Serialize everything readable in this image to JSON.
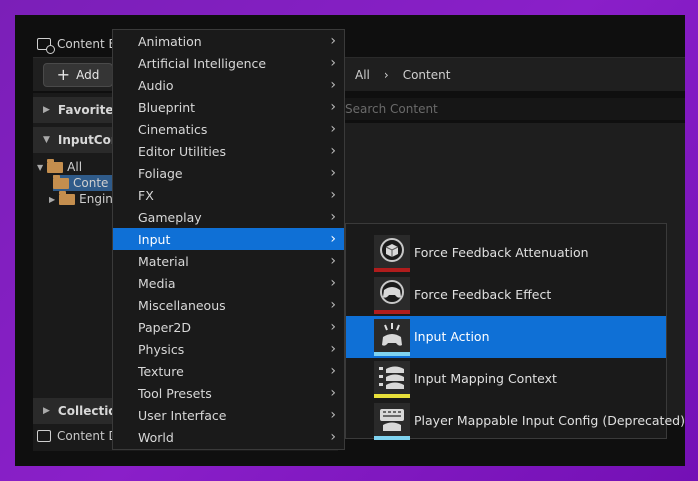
{
  "window": {
    "tab_title": "Content B",
    "add_button": "Add",
    "breadcrumb": [
      "All",
      "Content"
    ],
    "search_placeholder": "Search Content",
    "bottom_tab": "Content D"
  },
  "left_panel": {
    "favorites": "Favorites",
    "project": "InputCont",
    "collections": "Collection",
    "tree": [
      "All",
      "Conte",
      "Engin"
    ]
  },
  "menu": {
    "items": [
      "Animation",
      "Artificial Intelligence",
      "Audio",
      "Blueprint",
      "Cinematics",
      "Editor Utilities",
      "Foliage",
      "FX",
      "Gameplay",
      "Input",
      "Material",
      "Media",
      "Miscellaneous",
      "Paper2D",
      "Physics",
      "Texture",
      "Tool Presets",
      "User Interface",
      "World"
    ],
    "active_index": 9
  },
  "submenu": {
    "items": [
      {
        "label": "Force Feedback Attenuation",
        "icon": "force-feedback-attenuation-icon",
        "color": "#b01c1c"
      },
      {
        "label": "Force Feedback Effect",
        "icon": "force-feedback-effect-icon",
        "color": "#b01c1c"
      },
      {
        "label": "Input Action",
        "icon": "input-action-icon",
        "color": "#7fd3f0"
      },
      {
        "label": "Input Mapping Context",
        "icon": "input-mapping-context-icon",
        "color": "#e8e03a"
      },
      {
        "label": "Player Mappable Input Config (Deprecated)",
        "icon": "player-mappable-input-config-icon",
        "color": "#7fd3f0"
      }
    ],
    "active_index": 2
  },
  "colors": {
    "accent": "#0f70d6",
    "background": "#7b1fb8",
    "folder": "#c48e4e"
  }
}
